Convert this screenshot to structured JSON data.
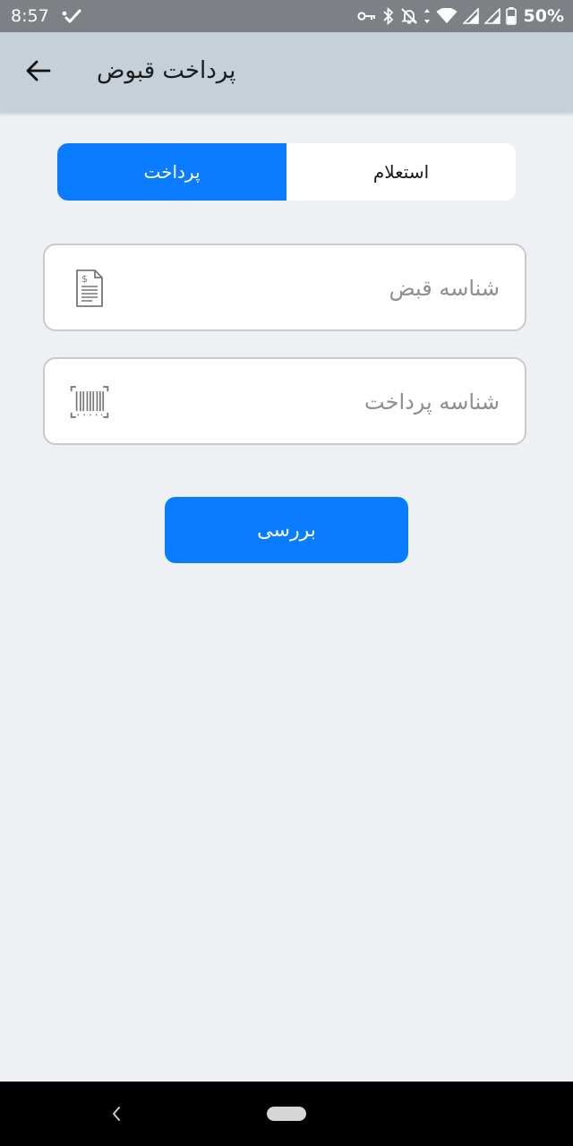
{
  "status_bar": {
    "time": "8:57",
    "battery_percent": "50%",
    "icons": [
      "missed-call-icon",
      "vpn-key-icon",
      "bluetooth-icon",
      "mute-icon",
      "wifi-icon",
      "signal-icon",
      "signal-icon",
      "battery-icon"
    ]
  },
  "app_bar": {
    "title": "پرداخت قبوض",
    "back_icon": "arrow-back-icon"
  },
  "tabs": {
    "active": "پرداخت",
    "inactive": "استعلام"
  },
  "form": {
    "bill_id": {
      "placeholder": "شناسه قبض",
      "value": "",
      "icon": "bill-document-icon"
    },
    "payment_id": {
      "placeholder": "شناسه پرداخت",
      "value": "",
      "icon": "barcode-scan-icon"
    },
    "submit_label": "بررسی"
  },
  "colors": {
    "status_bar": "#7d8185",
    "app_bar": "#c5d0d9",
    "background": "#eef0f4",
    "accent": "#0a7cff",
    "field_border": "#c8cacc"
  },
  "nav_bar": {
    "icons": [
      "nav-back-icon",
      "nav-home-pill"
    ]
  }
}
